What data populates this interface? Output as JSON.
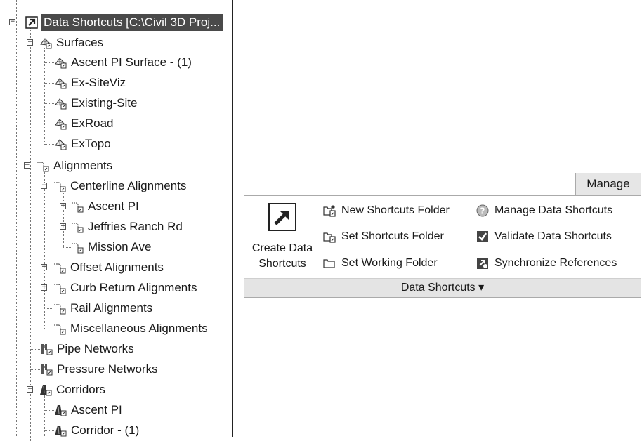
{
  "tree": {
    "root": "Data Shortcuts [C:\\Civil 3D Proj...",
    "surfaces": {
      "label": "Surfaces",
      "items": [
        "Ascent PI Surface - (1)",
        "Ex-SiteViz",
        "Existing-Site",
        "ExRoad",
        "ExTopo"
      ]
    },
    "alignments": {
      "label": "Alignments",
      "centerline": {
        "label": "Centerline Alignments",
        "items": [
          "Ascent PI",
          "Jeffries Ranch Rd",
          "Mission Ave"
        ]
      },
      "offset": "Offset Alignments",
      "curb_return": "Curb Return Alignments",
      "rail": "Rail Alignments",
      "misc": "Miscellaneous Alignments"
    },
    "pipe_networks": "Pipe Networks",
    "pressure_networks": "Pressure Networks",
    "corridors": {
      "label": "Corridors",
      "items": [
        "Ascent PI",
        "Corridor - (1)"
      ]
    },
    "toggle_expanded": "−",
    "toggle_collapsed": "+"
  },
  "ribbon": {
    "tab": "Manage",
    "create_line1": "Create Data",
    "create_line2": "Shortcuts",
    "new_folder": "New Shortcuts Folder",
    "set_folder": "Set Shortcuts Folder",
    "set_working": "Set Working Folder",
    "manage": "Manage Data Shortcuts",
    "validate": "Validate Data Shortcuts",
    "synchronize": "Synchronize References",
    "panel_title": "Data Shortcuts ▾"
  },
  "icons": {
    "shortcut": "shortcut-arrow-icon",
    "surface": "surface-icon",
    "alignment": "alignment-icon",
    "pipe": "pipe-network-icon",
    "corridor": "corridor-icon",
    "folder": "folder-icon",
    "help": "question-icon",
    "validate": "validate-icon",
    "sync": "synchronize-icon"
  }
}
